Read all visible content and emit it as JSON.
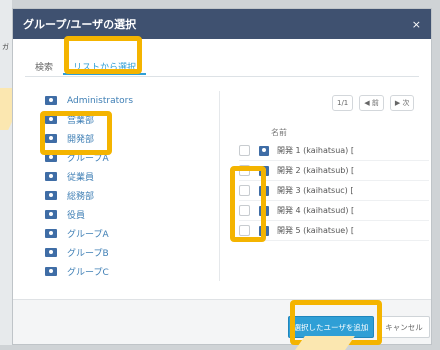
{
  "background": {
    "left_text": "ガ"
  },
  "dialog": {
    "title": "グループ/ユーザの選択",
    "close_icon": "×",
    "tabs": [
      {
        "label": "検索"
      },
      {
        "label": "リストから選択"
      }
    ],
    "groups": [
      {
        "label": "Administrators"
      },
      {
        "label": "営業部"
      },
      {
        "label": "開発部"
      },
      {
        "label": "グループA"
      },
      {
        "label": "従業員"
      },
      {
        "label": "総務部"
      },
      {
        "label": "役員"
      },
      {
        "label": "グループA"
      },
      {
        "label": "グループB"
      },
      {
        "label": "グループC"
      }
    ],
    "pager": {
      "page": "1/1",
      "prev": "◀ 前",
      "next": "▶ 次"
    },
    "column_header": "名前",
    "users": [
      {
        "label": "開発 1 (kaihatsua) ["
      },
      {
        "label": "開発 2 (kaihatsub) ["
      },
      {
        "label": "開発 3 (kaihatsuc) ["
      },
      {
        "label": "開発 4 (kaihatsud) ["
      },
      {
        "label": "開発 5 (kaihatsue) ["
      }
    ],
    "add_button": "選択したユーザを追加",
    "cancel_button": "キャンセル"
  },
  "colors": {
    "title_bar": "#3f5170",
    "accent": "#2f9fd6",
    "highlight": "#f4b400"
  }
}
